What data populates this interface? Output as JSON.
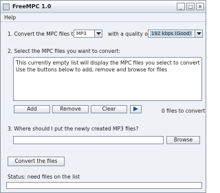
{
  "window": {
    "title": "FreeMPC 1.0"
  },
  "menu": {
    "help": "Help"
  },
  "convert_row": {
    "label_prefix": "1. Convert the MPC files to",
    "format_value": "MP3",
    "quality_label": "with a quality of",
    "quality_value": "192 kbps (Good)"
  },
  "select_section": {
    "label": "2. Select the MPC files you want to convert:",
    "list_lines": [
      "This currently empty list will display the MPC files you select to convert",
      "Use the buttons below to add, remove and browse for files"
    ],
    "add_label": "Add",
    "remove_label": "Remove",
    "clear_label": "Clear",
    "file_count": "0 files to convert"
  },
  "output_section": {
    "label": "3. Where should I put the newly created MP3 files?",
    "path_value": "",
    "browse_label": "Browse"
  },
  "convert_button": "Convert the files",
  "status": {
    "text": "Status:  need files on the list"
  }
}
